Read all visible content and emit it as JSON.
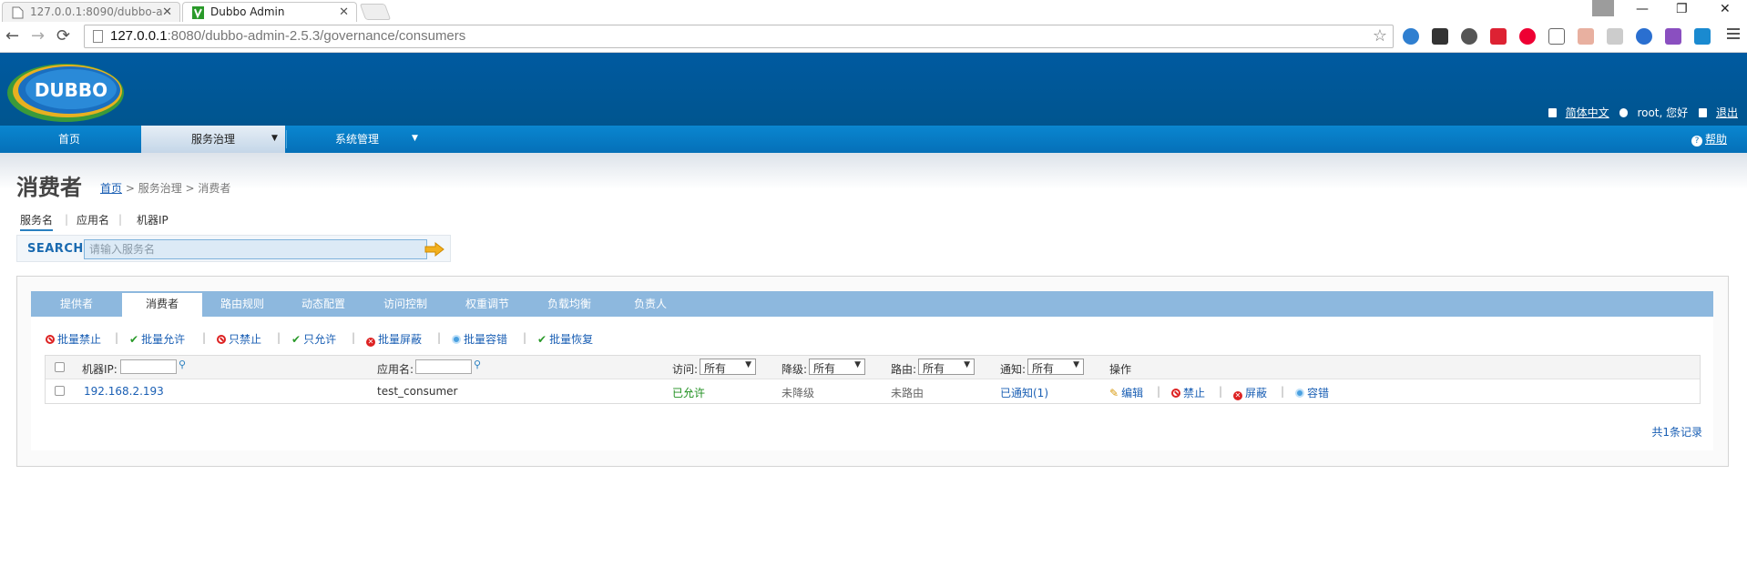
{
  "browser": {
    "tabs": [
      {
        "title": "127.0.0.1:8090/dubbo-a",
        "active": false
      },
      {
        "title": "Dubbo Admin",
        "active": true
      }
    ],
    "url_host": "127.0.0.1",
    "url_rest": ":8080/dubbo-admin-2.5.3/governance/consumers",
    "icons": {
      "back": "←",
      "forward": "→",
      "reload": "⟳",
      "star": "☆",
      "close": "✕",
      "minimize": "—",
      "maximize": "❐",
      "window_close": "✕"
    },
    "extension_colors": [
      "#2f7fd0",
      "#333",
      "#444",
      "#d23",
      "#e03",
      "#666",
      "#c87",
      "#aaa",
      "#2a6fd0",
      "#8a4fc0",
      "#1a8ad0"
    ]
  },
  "app": {
    "logo_text": "DUBBO",
    "header_links": {
      "language": "简体中文",
      "user": "root, 您好",
      "logout": "退出"
    },
    "nav": [
      {
        "label": "首页",
        "active": false
      },
      {
        "label": "服务治理",
        "active": true,
        "arrow": "▼"
      },
      {
        "label": "系统管理",
        "active": false,
        "arrow": "▼"
      }
    ],
    "help": "帮助",
    "help_icon": "?"
  },
  "page": {
    "title": "消费者",
    "breadcrumb": {
      "home": "首页",
      "sep1": " > ",
      "level2": "服务治理",
      "sep2": " > ",
      "current": "消费者"
    },
    "subtabs": [
      "服务名",
      "应用名",
      "机器IP"
    ],
    "search": {
      "label": "SEARCH",
      "placeholder": "请输入服务名"
    },
    "tabs": [
      "提供者",
      "消费者",
      "路由规则",
      "动态配置",
      "访问控制",
      "权重调节",
      "负载均衡",
      "负责人"
    ],
    "active_tab": "消费者",
    "actions": [
      "批量禁止",
      "批量允许",
      "只禁止",
      "只允许",
      "批量屏蔽",
      "批量容错",
      "批量恢复"
    ],
    "table": {
      "headers": {
        "ip": "机器IP:",
        "app": "应用名:",
        "access": "访问:",
        "degrade": "降级:",
        "route": "路由:",
        "notify": "通知:",
        "ops": "操作"
      },
      "filter_option": "所有",
      "rows": [
        {
          "ip": "192.168.2.193",
          "app": "test_consumer",
          "access": "已允许",
          "degrade": "未降级",
          "route": "未路由",
          "notify": "已通知(1)",
          "ops": [
            "编辑",
            "禁止",
            "屏蔽",
            "容错"
          ]
        }
      ]
    },
    "total": "共1条记录"
  }
}
